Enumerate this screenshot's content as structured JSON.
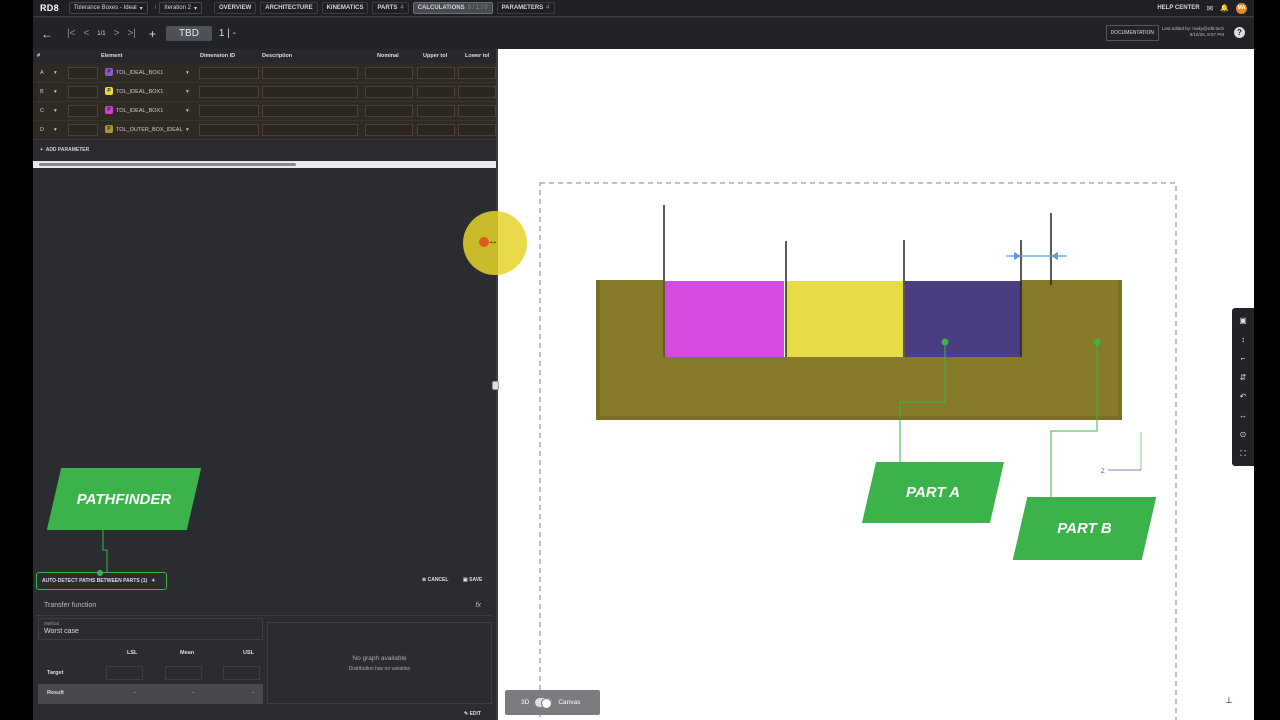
{
  "topbar": {
    "logo": "RD8",
    "project": "Tolerance Boxes - Ideal",
    "iteration": "Iteration 2",
    "nav": [
      {
        "label": "OVERVIEW",
        "count": ""
      },
      {
        "label": "ARCHITECTURE",
        "count": ""
      },
      {
        "label": "KINEMATICS",
        "count": "20"
      },
      {
        "label": "PARTS",
        "count": "4"
      },
      {
        "label": "CALCULATIONS",
        "count": "0 / 1 / 0"
      },
      {
        "label": "PARAMETERS",
        "count": "4"
      }
    ],
    "help": "HELP CENTER",
    "avatar": "MA"
  },
  "subbar": {
    "pager": "1/1",
    "title": "TBD",
    "counter": "1 | -",
    "doc_button": "DOCUMENTATION",
    "edited_line1": "Last edited by: maky@rd8.tech",
    "edited_line2": "9/16/25, 8:57 PM"
  },
  "table": {
    "headers": [
      "#",
      "Element",
      "Dimension ID",
      "Description",
      "Nominal",
      "Upper tol",
      "Lower tol"
    ],
    "rows": [
      {
        "id": "A",
        "chip": "P",
        "chip_color": "#8a5ad0",
        "element": "TOL_IDEAL_BOX1"
      },
      {
        "id": "B",
        "chip": "P",
        "chip_color": "#e8dc3a",
        "element": "TOL_IDEAL_BOX1"
      },
      {
        "id": "C",
        "chip": "P",
        "chip_color": "#d23fd2",
        "element": "TOL_IDEAL_BOX1"
      },
      {
        "id": "D",
        "chip": "P",
        "chip_color": "#a59a36",
        "element": "TOL_OUTER_BOX_IDEAL"
      }
    ],
    "add_parameter": "ADD PARAMETER"
  },
  "pathfinder": {
    "callout": "PATHFINDER",
    "auto_detect": "AUTO-DETECT PATHS BETWEEN PARTS (1)",
    "cancel": "CANCEL",
    "save": "SAVE"
  },
  "transfer": {
    "title": "Transfer function",
    "method_label": "Method",
    "method_value": "Worst case",
    "cols": [
      "LSL",
      "Mean",
      "USL"
    ],
    "target_label": "Target",
    "result_label": "Result",
    "result_values": [
      "-",
      "-",
      "-"
    ],
    "graph_title": "No graph available",
    "graph_sub": "Distribution has no variation",
    "edit": "EDIT"
  },
  "viewport": {
    "part_a": "PART A",
    "part_b": "PART B",
    "toggle_left": "3D",
    "toggle_right": "Canvas",
    "colors": {
      "outer": "#7a6f22",
      "magenta": "#d64ae0",
      "yellow": "#e6dc45",
      "purple": "#4a3e82",
      "green": "#3bb34a"
    }
  }
}
